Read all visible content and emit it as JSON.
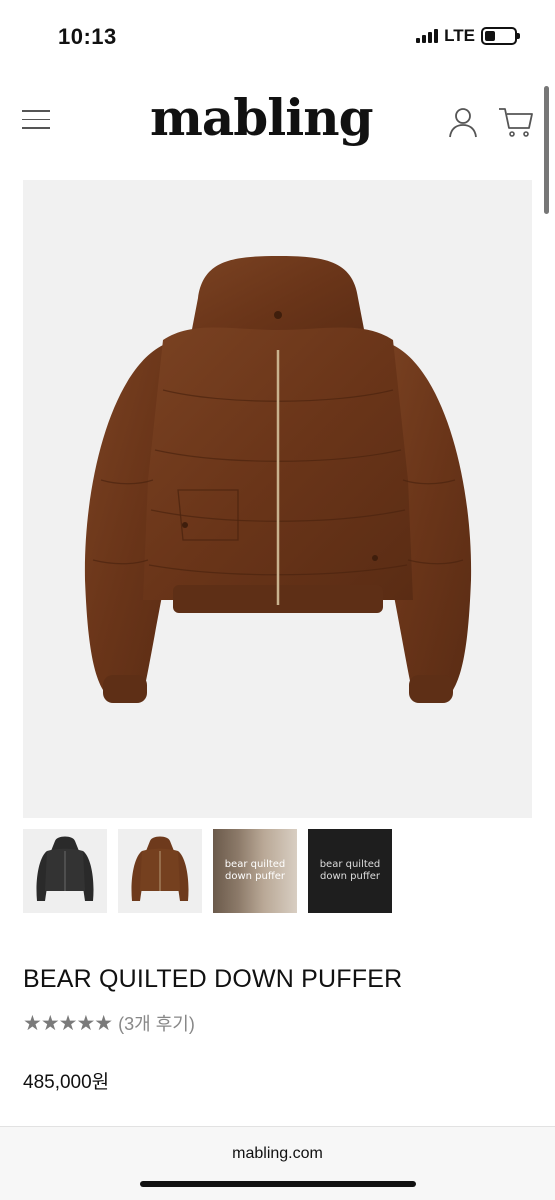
{
  "status_bar": {
    "time": "10:13",
    "network": "LTE",
    "battery_level": 0.35
  },
  "header": {
    "logo": "mabling",
    "icons": [
      "menu-icon",
      "user-icon",
      "cart-icon"
    ]
  },
  "gallery": {
    "main_image": "brown-puffer-jacket",
    "thumbnails": [
      {
        "name": "black-puffer-jacket",
        "text": ""
      },
      {
        "name": "brown-puffer-jacket",
        "text": ""
      },
      {
        "name": "lifestyle-photo",
        "text": "bear quilted\ndown puffer"
      },
      {
        "name": "promo-card",
        "text": "bear quilted\ndown puffer"
      }
    ]
  },
  "product": {
    "title": "BEAR QUILTED DOWN PUFFER",
    "stars": "★★★★★",
    "rating": 5,
    "reviews": "(3개 후기)",
    "price": "485,000원"
  },
  "browser": {
    "url": "mabling.com"
  },
  "colors": {
    "jacket_brown": "#6e3a1c",
    "jacket_black": "#2a2a2a",
    "star_gray": "#7a7a7a"
  }
}
